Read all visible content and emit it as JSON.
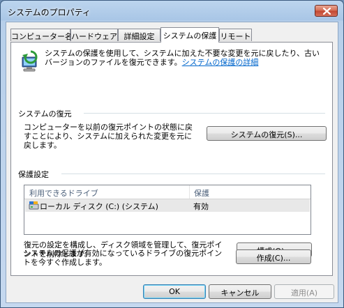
{
  "window": {
    "title": "システムのプロパティ"
  },
  "tabs": [
    {
      "label": "コンピューター名"
    },
    {
      "label": "ハードウェア"
    },
    {
      "label": "詳細設定"
    },
    {
      "label": "システムの保護"
    },
    {
      "label": "リモート"
    }
  ],
  "intro": {
    "text": "システムの保護を使用して、システムに加えた不要な変更を元に戻したり、古いバージョンのファイルを復元できます。",
    "link": "システムの保護の詳細"
  },
  "restore": {
    "heading": "システムの復元",
    "description": "コンピューターを以前の復元ポイントの状態に戻すことにより、システムに加えられた変更を元に戻します。",
    "button": "システムの復元(S)..."
  },
  "protection": {
    "heading": "保護設定",
    "columns": [
      "利用できるドライブ",
      "保護"
    ],
    "rows": [
      {
        "drive": "ローカル ディスク (C:) (システム)",
        "status": "有効"
      }
    ]
  },
  "configure": {
    "description": "復元の設定を構成し、ディスク領域を管理して、復元ポイントを削除します。",
    "button": "構成(O)..."
  },
  "create": {
    "description": "システムの保護が有効になっているドライブの復元ポイントを今すぐ作成します。",
    "button": "作成(C)..."
  },
  "footer": {
    "ok": "OK",
    "cancel": "キャンセル",
    "apply": "適用(A)"
  }
}
